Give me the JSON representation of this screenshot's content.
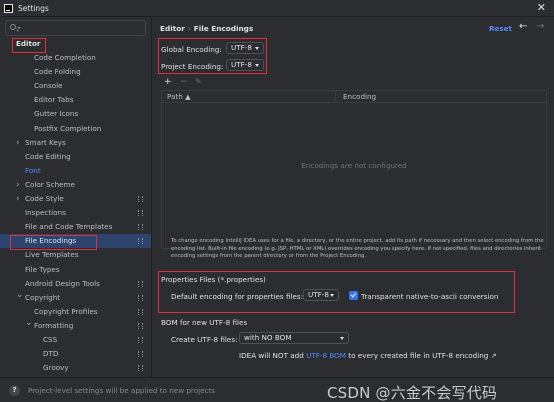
{
  "window": {
    "title": "Settings",
    "close_glyph": "✕"
  },
  "sidebar": {
    "search_placeholder": "",
    "items": [
      {
        "label": "Editor",
        "level": 0,
        "arrow": "",
        "gear": false,
        "style": "header"
      },
      {
        "label": "Code Completion",
        "level": 2,
        "arrow": "",
        "gear": false
      },
      {
        "label": "Code Folding",
        "level": 2,
        "arrow": "",
        "gear": false
      },
      {
        "label": "Console",
        "level": 2,
        "arrow": "",
        "gear": false
      },
      {
        "label": "Editor Tabs",
        "level": 2,
        "arrow": "",
        "gear": false
      },
      {
        "label": "Gutter Icons",
        "level": 2,
        "arrow": "",
        "gear": false
      },
      {
        "label": "Postfix Completion",
        "level": 2,
        "arrow": "",
        "gear": false
      },
      {
        "label": "Smart Keys",
        "level": 1,
        "arrow": ">",
        "gear": false
      },
      {
        "label": "Code Editing",
        "level": 1,
        "arrow": "",
        "gear": false
      },
      {
        "label": "Font",
        "level": 1,
        "arrow": "",
        "gear": false,
        "style": "link"
      },
      {
        "label": "Color Scheme",
        "level": 1,
        "arrow": ">",
        "gear": false
      },
      {
        "label": "Code Style",
        "level": 1,
        "arrow": ">",
        "gear": true
      },
      {
        "label": "Inspections",
        "level": 1,
        "arrow": "",
        "gear": true
      },
      {
        "label": "File and Code Templates",
        "level": 1,
        "arrow": "",
        "gear": true
      },
      {
        "label": "File Encodings",
        "level": 1,
        "arrow": "",
        "gear": true,
        "style": "selected"
      },
      {
        "label": "Live Templates",
        "level": 1,
        "arrow": "",
        "gear": false
      },
      {
        "label": "File Types",
        "level": 1,
        "arrow": "",
        "gear": false
      },
      {
        "label": "Android Design Tools",
        "level": 1,
        "arrow": "",
        "gear": true
      },
      {
        "label": "Copyright",
        "level": 1,
        "arrow": "v",
        "gear": true
      },
      {
        "label": "Copyright Profiles",
        "level": 2,
        "arrow": "",
        "gear": true
      },
      {
        "label": "Formatting",
        "level": 2,
        "arrow": "v",
        "gear": true
      },
      {
        "label": "CSS",
        "level": 3,
        "arrow": "",
        "gear": true
      },
      {
        "label": "DTD",
        "level": 3,
        "arrow": "",
        "gear": true
      },
      {
        "label": "Groovy",
        "level": 3,
        "arrow": "",
        "gear": true
      }
    ]
  },
  "main": {
    "breadcrumb": {
      "parent": "Editor",
      "separator": "›",
      "current": "File Encodings"
    },
    "reset_label": "Reset",
    "nav_back": "←",
    "nav_forward": "→",
    "global_encoding": {
      "label": "Global Encoding:",
      "value": "UTF-8"
    },
    "project_encoding": {
      "label": "Project Encoding:",
      "value": "UTF-8"
    },
    "toolbar": {
      "add": "+",
      "remove": "−",
      "edit": "✎"
    },
    "table": {
      "columns": [
        "Path ▲",
        "Encoding"
      ],
      "empty_text": "Encodings are not configured"
    },
    "info_text": "To change encoding IntelliJ IDEA uses for a file, a directory, or the entire project, add its path if necessary and then select encoding from the encoding list. Built-in file encoding (e.g. JSP, HTML or XML) overrides encoding you specify here. If not specified, files and directories inherit encoding settings from the parent directory or from the Project Encoding.",
    "properties": {
      "title": "Properties Files (*.properties)",
      "default_label": "Default encoding for properties files:",
      "default_value": "UTF-8",
      "transparent_label": "Transparent native-to-ascii conversion",
      "transparent_checked": true
    },
    "bom": {
      "title": "BOM for new UTF-8 files",
      "create_label": "Create UTF-8 files:",
      "create_value": "with NO BOM",
      "note_prefix": "IDEA will NOT add ",
      "note_link": "UTF-8 BOM",
      "note_suffix": " to every created file in UTF-8 encoding ↗"
    }
  },
  "status": {
    "help_glyph": "?",
    "text": "Project-level settings will be applied to new projects",
    "watermark": "CSDN @六金不会写代码"
  },
  "colors": {
    "background": "#2b2d30",
    "selection": "#2e436e",
    "accent": "#548af7",
    "annotation_red": "#e0303a"
  }
}
